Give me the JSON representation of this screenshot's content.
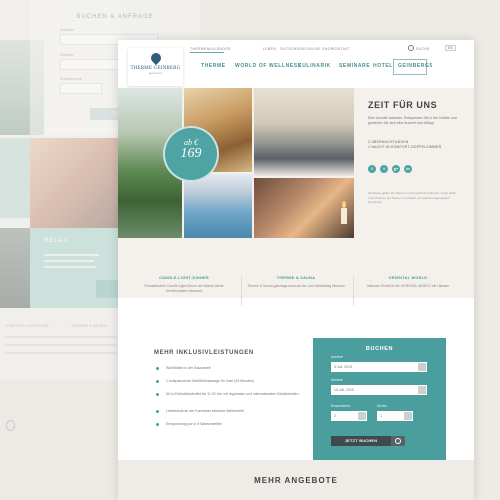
{
  "background": {
    "booking_title": "BUCHEN & ANFRAGE",
    "booking_labels": [
      "Anreise",
      "Abreise",
      "Erwachsene"
    ],
    "booking_button": "SUCHEN",
    "relax_title": "RELAX",
    "text_labels": [
      "VITALHOTEL GOTSCHEBE",
      "THERMEN & SAUNEN"
    ]
  },
  "header": {
    "logo_name": "THERME GEINBERG",
    "logo_tag": "spa resort",
    "utility_links": [
      "THERMENKALENDER",
      "LEBEN",
      "GUTSCHEINE",
      "ONLINE SHOP",
      "KONTAKT"
    ],
    "search_label": "SUCHE",
    "language": "EN",
    "nav": [
      "THERME",
      "WORLD OF WELLNESS",
      "KULINARIK",
      "SEMINARE",
      "HOTEL",
      "GEINBERG5"
    ]
  },
  "hero": {
    "price_prefix": "ab €",
    "price_value": "169",
    "title": "ZEIT FÜR UNS",
    "intro": "Eine Auszeit zweisam. Entspannen Sie in der Karibik und genießen Sie sich eine Auszeit vom Alltag!",
    "list": [
      "2 ÜBERNACHTUNGEN",
      "1 NACHT IM KOMFORT-DOPPELZIMMER"
    ],
    "social": [
      "f",
      "t",
      "g+",
      "in"
    ],
    "small_print": "Ab Preise gelten pro Person im Doppelzimmer Einzel- zuzgl. EUR 1,00 Ortstaxe pro Person und Nacht und werden tagesaktuell berechnet."
  },
  "features": [
    {
      "title": "CANDLE-LIGHT-DINNER",
      "desc": "Romantisches Candle-Light-Dinner am Abend (siehe Verwöhnpaket Inklusive)"
    },
    {
      "title": "THERME & SAUNA",
      "desc": "Therme & Sauna ganztags auch am An- und Abreisetag inklusive"
    },
    {
      "title": "ORIENTAL WORLD",
      "desc": "Inklusive Eintritt in die ORIENTAL WORLD mit Hamam"
    }
  ],
  "inclusive": {
    "title": "MEHR INKLUSIVLEISTUNGEN",
    "items": [
      "Wohlfühlen in der Saunawelt",
      "1 entspannende Wohlfühlmassage für Zwei (25 Minuten)",
      "All-in-Frühstücksbuffet bis 11.00 Uhr mit regionalen und internationalen Köstlichkeiten",
      "Liebsmüsik an der Karnmbar inklusive Weißenbhfl",
      "Entspannung pur in 5 Wasserwelten"
    ]
  },
  "booking": {
    "title": "BUCHEN",
    "arrival_label": "Anreise",
    "arrival_value": "5.Juli, 2015",
    "departure_label": "Abreise",
    "departure_value": "15.Juli, 2015",
    "adults_label": "Erwachsene",
    "adults_value": "2",
    "children_label": "Kinder",
    "children_value": "1",
    "button": "JETZT BUCHEN"
  },
  "more": {
    "title": "MEHR ANGEBOTE"
  }
}
